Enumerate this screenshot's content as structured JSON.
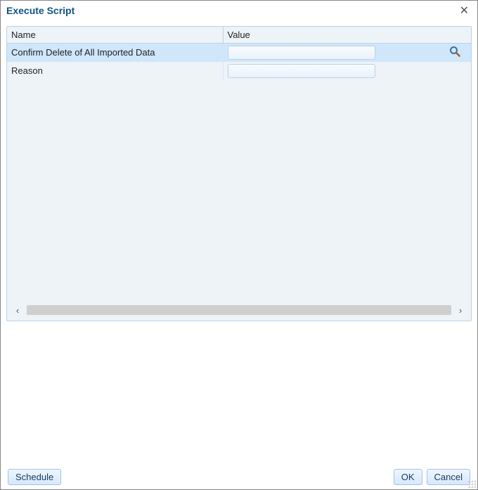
{
  "dialog": {
    "title": "Execute Script"
  },
  "table": {
    "headers": {
      "name": "Name",
      "value": "Value"
    },
    "rows": [
      {
        "name": "Confirm Delete of All Imported Data",
        "value": "",
        "highlighted": true,
        "lookup": true
      },
      {
        "name": "Reason",
        "value": "",
        "highlighted": false,
        "lookup": false
      }
    ]
  },
  "buttons": {
    "schedule": "Schedule",
    "ok": "OK",
    "cancel": "Cancel"
  }
}
